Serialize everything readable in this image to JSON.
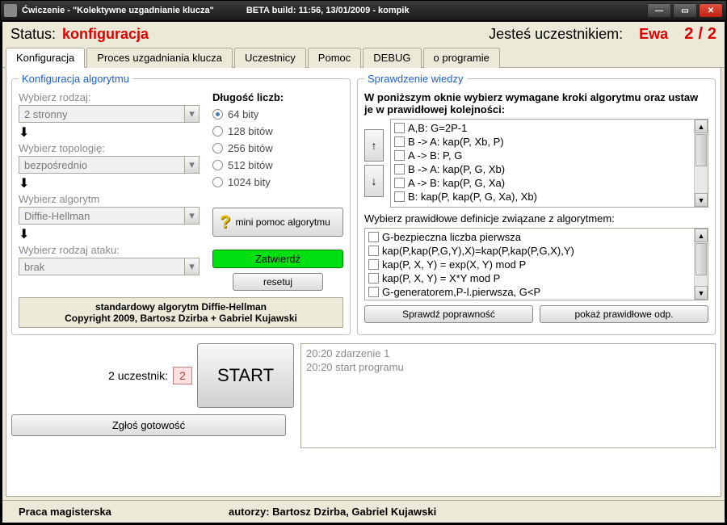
{
  "titlebar": {
    "title": "Ćwiczenie - \"Kolektywne uzgadnianie klucza\"",
    "build": "BETA build: 11:56, 13/01/2009 - kompik"
  },
  "status": {
    "label": "Status:",
    "value": "konfiguracja",
    "participant_label": "Jesteś uczestnikiem:",
    "name": "Ewa",
    "num": "2",
    "total": "2"
  },
  "tabs": [
    "Konfiguracja",
    "Proces uzgadniania klucza",
    "Uczestnicy",
    "Pomoc",
    "DEBUG",
    "o programie"
  ],
  "config": {
    "legend": "Konfiguracja algorytmu",
    "type_label": "Wybierz rodzaj:",
    "type_value": "2 stronny",
    "topology_label": "Wybierz topologię:",
    "topology_value": "bezpośrednio",
    "algorithm_label": "Wybierz algorytm",
    "algorithm_value": "Diffie-Hellman",
    "attack_label": "Wybierz rodzaj ataku:",
    "attack_value": "brak",
    "length_title": "Długość liczb:",
    "length_options": [
      "64 bity",
      "128 bitów",
      "256 bitów",
      "512 bitów",
      "1024 bity"
    ],
    "help_btn": "mini pomoc algorytmu",
    "confirm_btn": "Zatwierdź",
    "reset_btn": "resetuj",
    "copyright_line1": "standardowy algorytm Diffie-Hellman",
    "copyright_line2": "Copyright 2009, Bartosz Dzirba + Gabriel Kujawski"
  },
  "knowledge": {
    "legend": "Sprawdzenie wiedzy",
    "intro": "W poniższym oknie wybierz wymagane kroki algorytmu oraz ustaw je w prawidłowej kolejności:",
    "steps": [
      "A,B: G=2P-1",
      "B -> A: kap(P, Xb, P)",
      "A -> B: P, G",
      "B -> A: kap(P, G, Xb)",
      "A -> B: kap(P, G, Xa)",
      "B: kap(P, kap(P, G, Xa), Xb)"
    ],
    "defs_label": "Wybierz prawidłowe definicje związane z algorytmem:",
    "defs": [
      "G-bezpieczna liczba pierwsza",
      "kap(P,kap(P,G,Y),X)=kap(P,kap(P,G,X),Y)",
      "kap(P, X, Y) = exp(X, Y) mod P",
      "kap(P, X, Y) = X*Y mod P",
      "G-generatorem,P-l.pierwsza, G<P"
    ],
    "check_btn": "Sprawdź poprawność",
    "show_btn": "pokaż prawidłowe odp."
  },
  "lower": {
    "participant_label": "2 uczestnik:",
    "participant_value": "2",
    "start_btn": "START",
    "ready_btn": "Zgłoś gotowość",
    "log": [
      "20:20 zdarzenie 1",
      "20:20 start programu"
    ]
  },
  "footer": {
    "left": "Praca magisterska",
    "right": "autorzy: Bartosz Dzirba, Gabriel Kujawski"
  }
}
